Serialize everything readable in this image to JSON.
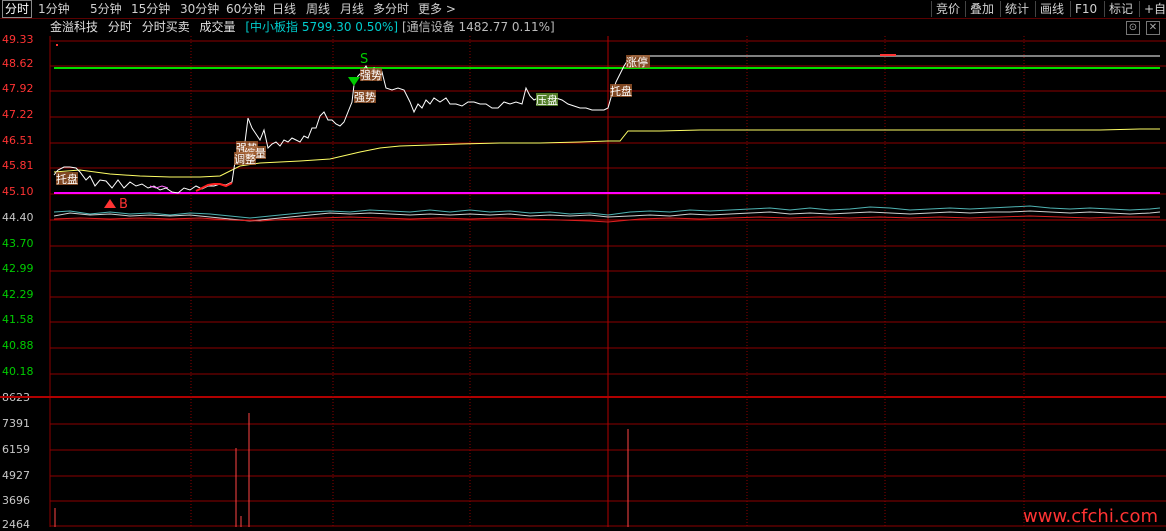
{
  "toolbar": {
    "tabs": [
      "分时",
      "1分钟",
      "5分钟",
      "15分钟",
      "30分钟",
      "60分钟",
      "日线",
      "周线",
      "月线",
      "多分时",
      "更多 >"
    ],
    "active_tab": 0,
    "right_tools": [
      "竞价",
      "叠加",
      "统计",
      "画线",
      "F10",
      "标记",
      "+自选"
    ]
  },
  "info": {
    "stock_name": "金溢科技",
    "view_label": "分时",
    "buy_sell_label": "分时买卖",
    "volume_label": "成交量",
    "index1": "[中小板指 5799.30 0.50%]",
    "index2": "[通信设备 1482.77 0.11%]"
  },
  "price_axis": {
    "labels": [
      "49.33",
      "48.62",
      "47.92",
      "47.22",
      "46.51",
      "45.81",
      "45.10",
      "44.40",
      "43.70",
      "42.99",
      "42.29",
      "41.58",
      "40.88",
      "40.18"
    ],
    "up_color": "#ff3333",
    "mid_color": "#c8c8c8",
    "down_color": "#00cc00"
  },
  "volume_axis": {
    "labels": [
      "8623",
      "7391",
      "6159",
      "4927",
      "3696",
      "2464"
    ]
  },
  "signals": {
    "buy": "B",
    "sell": "S",
    "tags": [
      "托盘",
      "强势",
      "缩量",
      "调整",
      "强势",
      "强势",
      "压盘",
      "托盘",
      "涨停"
    ]
  },
  "controls": {
    "restore": "⊙",
    "close": "✕"
  },
  "watermark": "www.cfchi.com",
  "colors": {
    "price_line": "#ffffff",
    "avg_line": "#ffff66",
    "green_line": "#00dd00",
    "magenta_line": "#ff00ff",
    "grid": "#8b0000",
    "volume_bar": "#ff4444"
  }
}
